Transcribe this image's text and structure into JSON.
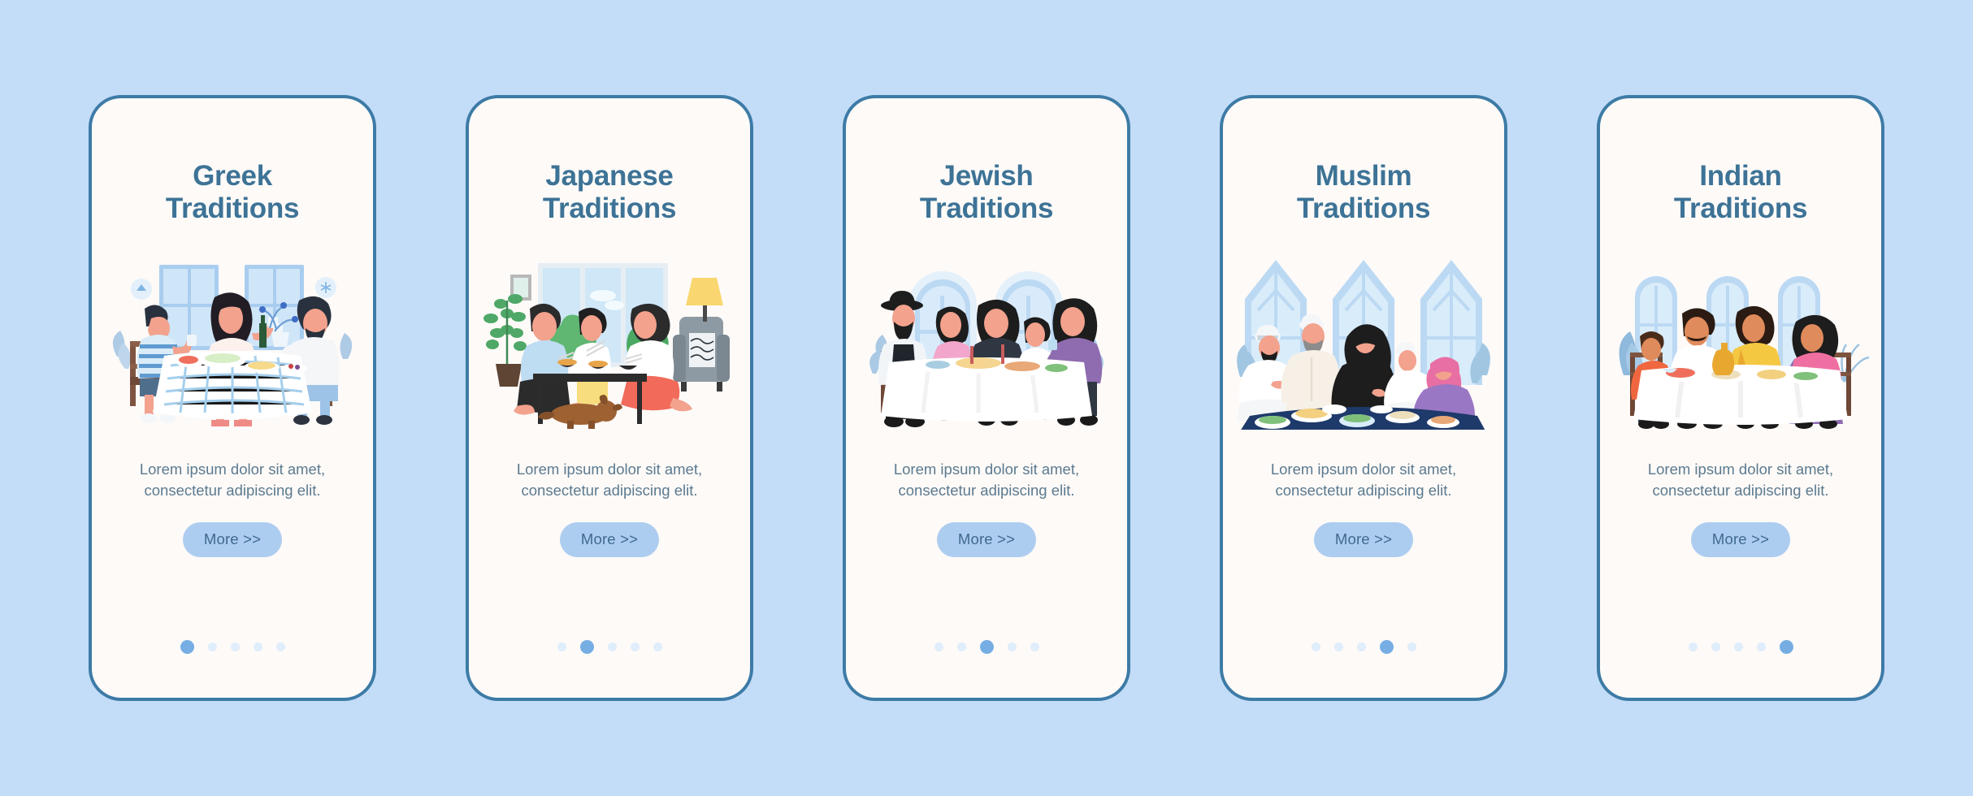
{
  "background_color": "#c3dcf8",
  "theme": {
    "frame_border": "#3d7ba6",
    "card_background": "#fdfaf8",
    "title_color": "#3d7396",
    "body_color": "#5c7a8f",
    "button_background": "#adcdf0",
    "button_text_color": "#3f6a8c",
    "dot_inactive": "#e0edfb",
    "dot_active": "#76aee4"
  },
  "screens": [
    {
      "id": "greek",
      "title": "Greek\nTraditions",
      "body": "Lorem ipsum dolor sit amet,\nconsectetur adipiscing elit.",
      "button_label": "More >>",
      "illustration_name": "greek-family-dinner-illustration",
      "dots_total": 5,
      "dot_active_index": 1
    },
    {
      "id": "japanese",
      "title": "Japanese\nTraditions",
      "body": "Lorem ipsum dolor sit amet,\nconsectetur adipiscing elit.",
      "button_label": "More >>",
      "illustration_name": "japanese-family-dinner-illustration",
      "dots_total": 5,
      "dot_active_index": 2
    },
    {
      "id": "jewish",
      "title": "Jewish\nTraditions",
      "body": "Lorem ipsum dolor sit amet,\nconsectetur adipiscing elit.",
      "button_label": "More >>",
      "illustration_name": "jewish-family-dinner-illustration",
      "dots_total": 5,
      "dot_active_index": 3
    },
    {
      "id": "muslim",
      "title": "Muslim\nTraditions",
      "body": "Lorem ipsum dolor sit amet,\nconsectetur adipiscing elit.",
      "button_label": "More >>",
      "illustration_name": "muslim-family-dinner-illustration",
      "dots_total": 5,
      "dot_active_index": 4
    },
    {
      "id": "indian",
      "title": "Indian\nTraditions",
      "body": "Lorem ipsum dolor sit amet,\nconsectetur adipiscing elit.",
      "button_label": "More >>",
      "illustration_name": "indian-family-dinner-illustration",
      "dots_total": 5,
      "dot_active_index": 5
    }
  ]
}
